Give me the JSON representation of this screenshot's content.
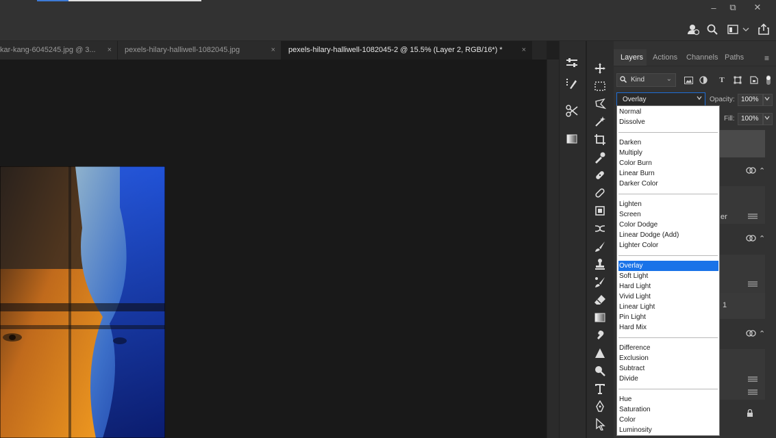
{
  "window_controls": {
    "minimize": "–",
    "restore": "⧉",
    "close": "✕"
  },
  "tabs": [
    {
      "label": "kar-kang-6045245.jpg @ 3...",
      "close": "×"
    },
    {
      "label": "pexels-hilary-halliwell-1082045.jpg",
      "close": "×"
    },
    {
      "label": "pexels-hilary-halliwell-1082045-2 @ 15.5% (Layer 2, RGB/16*) *",
      "close": "×"
    }
  ],
  "panel_tabs": [
    "Layers",
    "Actions",
    "Channels",
    "Paths"
  ],
  "kind_filter": "Kind",
  "blend_mode": {
    "current": "Overlay"
  },
  "opacity": {
    "label": "Opacity:",
    "value": "100%"
  },
  "fill": {
    "label": "Fill:",
    "value": "100%"
  },
  "dropdown_groups": [
    [
      "Normal",
      "Dissolve"
    ],
    [
      "Darken",
      "Multiply",
      "Color Burn",
      "Linear Burn",
      "Darker Color"
    ],
    [
      "Lighten",
      "Screen",
      "Color Dodge",
      "Linear Dodge (Add)",
      "Lighter Color"
    ],
    [
      "Overlay",
      "Soft Light",
      "Hard Light",
      "Vivid Light",
      "Linear Light",
      "Pin Light",
      "Hard Mix"
    ],
    [
      "Difference",
      "Exclusion",
      "Subtract",
      "Divide"
    ],
    [
      "Hue",
      "Saturation",
      "Color",
      "Luminosity"
    ]
  ],
  "selected_mode": "Overlay",
  "layer_partial_texts": {
    "er": "er",
    "one": "1"
  },
  "tool_icons": [
    "move-icon",
    "marquee-icon",
    "lasso-icon",
    "magic-wand-icon",
    "crop-icon",
    "eyedropper-icon",
    "healing-icon",
    "bandage-icon",
    "frame-icon",
    "patch-icon",
    "brush-icon",
    "stamp-icon",
    "history-brush-icon",
    "eraser-icon",
    "gradient-icon",
    "smudge-icon",
    "sharpen-icon",
    "dodge-icon",
    "type-icon",
    "pen-icon",
    "path-select-icon"
  ],
  "colors": {
    "accent": "#1a73e8",
    "panel": "#323232",
    "canvas": "#191919"
  }
}
